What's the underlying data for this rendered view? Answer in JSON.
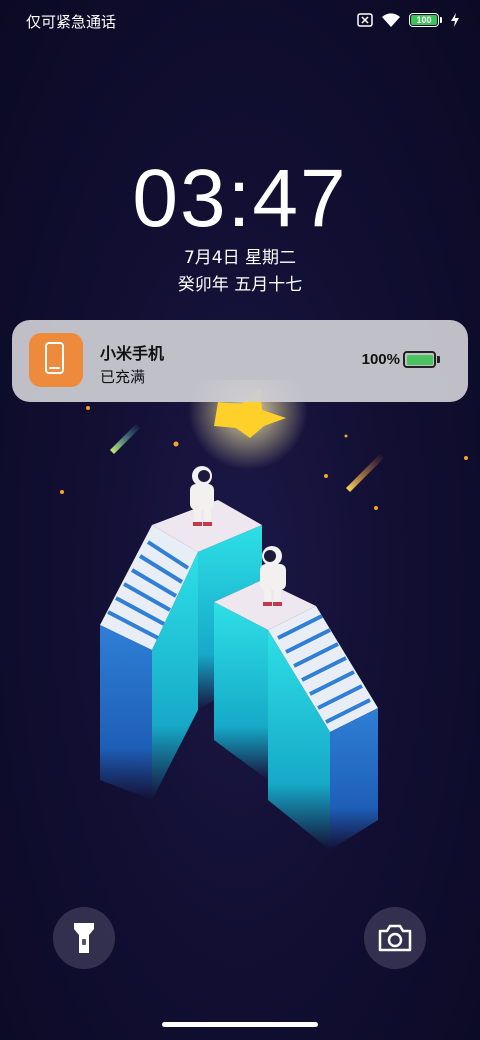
{
  "status_bar": {
    "carrier_text": "仅可紧急通话",
    "battery_text": "100",
    "battery_level": 1.0,
    "icons": [
      "no-sim-icon",
      "wifi-icon",
      "battery-icon",
      "charging-bolt-icon"
    ]
  },
  "lockscreen": {
    "time": "03:47",
    "date": "7月4日 星期二",
    "lunar_date": "癸卯年 五月十七"
  },
  "notification": {
    "app_icon": "phone-icon",
    "title": "小米手机",
    "subtitle": "已充满",
    "battery_percent": "100%",
    "battery_level": 1.0,
    "colors": {
      "icon_bg": "#ee8a3b",
      "battery_fill": "#4cc25e"
    }
  },
  "quick_actions": {
    "left": "flashlight-icon",
    "right": "camera-icon"
  }
}
